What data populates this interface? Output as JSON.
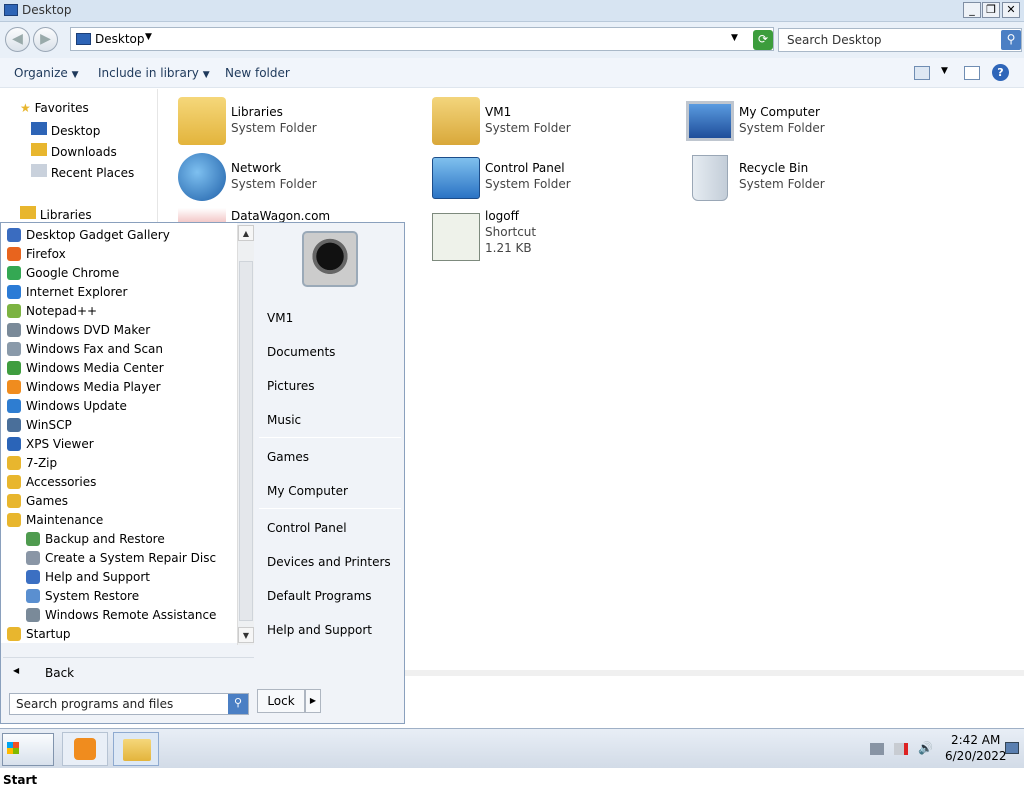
{
  "window": {
    "title": "Desktop",
    "controls": [
      "_",
      "❐",
      "✕"
    ]
  },
  "address": {
    "location": "Desktop"
  },
  "search": {
    "placeholder": "Search Desktop"
  },
  "commands": {
    "organize": "Organize",
    "include": "Include in library",
    "new_folder": "New folder"
  },
  "nav": {
    "favorites": "Favorites",
    "items": [
      "Desktop",
      "Downloads",
      "Recent Places"
    ],
    "libraries": "Libraries"
  },
  "content": {
    "items": [
      {
        "name": "Libraries",
        "sub": "System Folder",
        "icon": "libraries-icon"
      },
      {
        "name": "VM1",
        "sub": "System Folder",
        "icon": "user-folder-icon"
      },
      {
        "name": "My Computer",
        "sub": "System Folder",
        "icon": "computer-icon"
      },
      {
        "name": "Network",
        "sub": "System Folder",
        "icon": "network-icon"
      },
      {
        "name": "Control Panel",
        "sub": "System Folder",
        "icon": "control-panel-icon"
      },
      {
        "name": "Recycle Bin",
        "sub": "System Folder",
        "icon": "recycle-bin-icon"
      },
      {
        "name": "DataWagon.com",
        "sub": "",
        "icon": "datawagon-icon"
      },
      {
        "name": "logoff",
        "sub": "Shortcut",
        "size": "1.21 KB",
        "icon": "shortcut-icon"
      }
    ]
  },
  "startmenu": {
    "programs": [
      {
        "label": "Desktop Gadget Gallery",
        "color": "#3a6cc0"
      },
      {
        "label": "Firefox",
        "color": "#e8641e"
      },
      {
        "label": "Google Chrome",
        "color": "#34a853"
      },
      {
        "label": "Internet Explorer",
        "color": "#2b7bd6"
      },
      {
        "label": "Notepad++",
        "color": "#7cb342"
      },
      {
        "label": "Windows DVD Maker",
        "color": "#7a8a99"
      },
      {
        "label": "Windows Fax and Scan",
        "color": "#8a9aaa"
      },
      {
        "label": "Windows Media Center",
        "color": "#3f9d3f"
      },
      {
        "label": "Windows Media Player",
        "color": "#f08c1e"
      },
      {
        "label": "Windows Update",
        "color": "#2e7dd1"
      },
      {
        "label": "WinSCP",
        "color": "#4a6f9a"
      },
      {
        "label": "XPS Viewer",
        "color": "#2a64b8"
      },
      {
        "label": "7-Zip",
        "color": "#e8b62e"
      },
      {
        "label": "Accessories",
        "color": "#e8b62e"
      },
      {
        "label": "Games",
        "color": "#e8b62e"
      },
      {
        "label": "Maintenance",
        "color": "#e8b62e"
      },
      {
        "label": "Backup and Restore",
        "color": "#4f9b4f",
        "sub": true
      },
      {
        "label": "Create a System Repair Disc",
        "color": "#8a96a6",
        "sub": true
      },
      {
        "label": "Help and Support",
        "color": "#3b6fc2",
        "sub": true
      },
      {
        "label": "System Restore",
        "color": "#5a8fd0",
        "sub": true
      },
      {
        "label": "Windows Remote Assistance",
        "color": "#7a8a99",
        "sub": true
      },
      {
        "label": "Startup",
        "color": "#e8b62e"
      }
    ],
    "back": "Back",
    "search_placeholder": "Search programs and files",
    "right": [
      "VM1",
      "Documents",
      "Pictures",
      "Music",
      "Games",
      "My Computer",
      "Control Panel",
      "Devices and Printers",
      "Default Programs",
      "Help and Support"
    ],
    "lock": "Lock"
  },
  "taskbar": {
    "start": "Start",
    "time": "2:42 AM",
    "date": "6/20/2022"
  }
}
